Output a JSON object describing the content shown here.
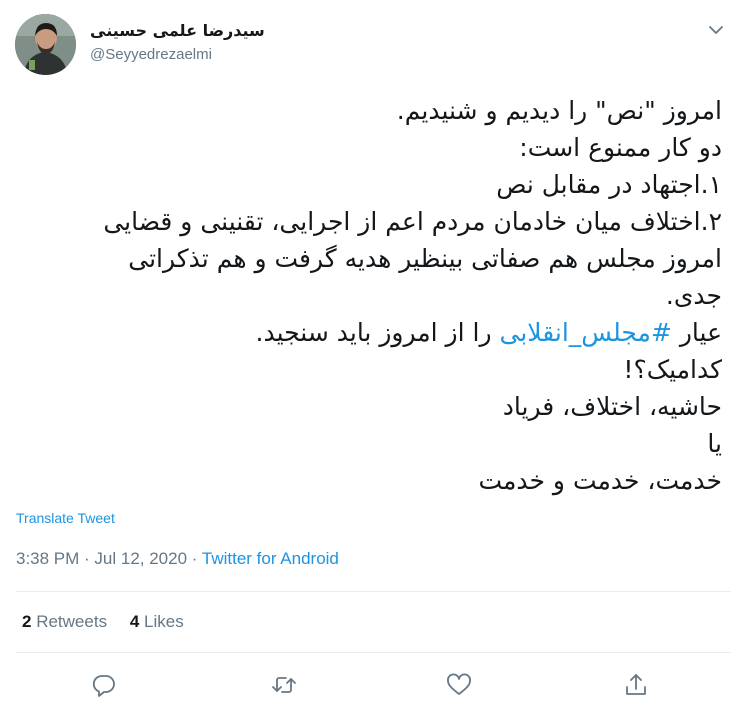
{
  "author": {
    "display_name": "سیدرضا علمی حسینی",
    "handle": "@Seyyedrezaelmi"
  },
  "tweet": {
    "line1": "امروز \"نص\" را دیدیم و شنیدیم.",
    "line2": "دو کار ممنوع است:",
    "line3": "۱.اجتهاد در مقابل نص",
    "line4": "۲.اختلاف میان خادمان مردم اعم از اجرایی، تقنینی و قضایی",
    "line5": "امروز مجلس هم صفاتی بینظیر هدیه گرفت و هم تذکراتی",
    "line6": "جدی.",
    "line7_before": "عیار ",
    "hashtag": "#مجلس_انقلابی",
    "line7_after": " را از امروز باید سنجید.",
    "line8": "کدامیک؟!",
    "line9": "حاشیه، اختلاف، فریاد",
    "line10": "یا",
    "line11": "خدمت، خدمت و خدمت"
  },
  "translate_label": "Translate Tweet",
  "meta": {
    "time": "3:38 PM",
    "separator1": " · ",
    "date": "Jul 12, 2020",
    "separator2": " · ",
    "source": "Twitter for Android"
  },
  "stats": {
    "retweets_count": "2",
    "retweets_label": "Retweets",
    "likes_count": "4",
    "likes_label": "Likes"
  },
  "icons": {
    "caret": "chevron-down-icon",
    "reply": "reply-icon",
    "retweet": "retweet-icon",
    "like": "heart-icon",
    "share": "share-icon"
  },
  "colors": {
    "link": "#1b95e0",
    "secondary_text": "#657786",
    "divider": "#e6ecf0"
  }
}
